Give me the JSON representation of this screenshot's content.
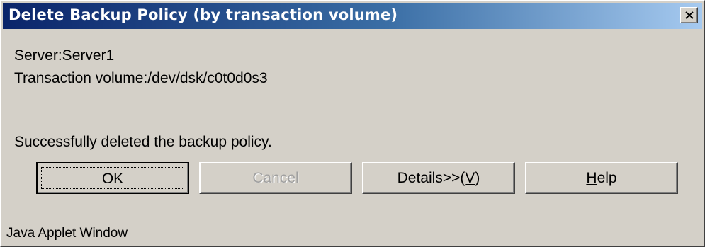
{
  "window": {
    "title": "Delete Backup Policy (by transaction volume)",
    "close_icon": "close-x-icon"
  },
  "info": {
    "server": "Server:Server1",
    "volume": "Transaction volume:/dev/dsk/c0t0d0s3"
  },
  "message": "Successfully deleted the backup policy.",
  "buttons": {
    "ok": "OK",
    "cancel": "Cancel",
    "details_prefix": "Details>>(",
    "details_mnemonic": "V",
    "details_suffix": ")",
    "help_mnemonic": "H",
    "help_rest": "elp"
  },
  "status": {
    "applet_label": "Java Applet Window"
  },
  "colors": {
    "titlebar_start": "#0a246a",
    "titlebar_end": "#a6caf0",
    "face": "#d4d0c8"
  }
}
